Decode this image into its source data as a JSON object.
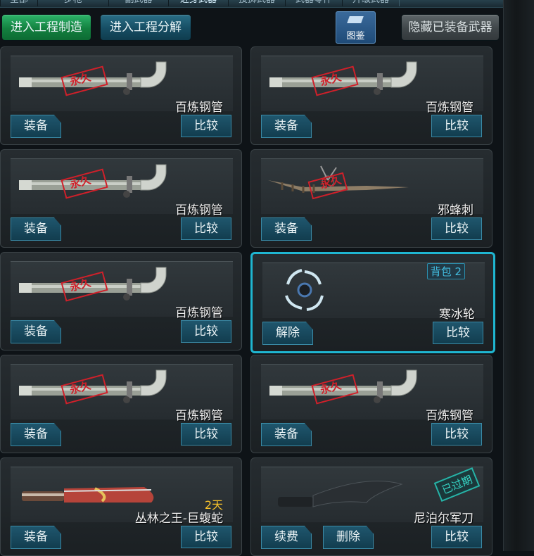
{
  "top_tabs": [
    "全部",
    "步枪",
    "副武器",
    "近身武器",
    "投掷武器",
    "武器零件",
    "升级武器"
  ],
  "toolbar": {
    "engineer_make": "进入工程制造",
    "engineer_disassemble": "进入工程分解",
    "codex": "图鉴",
    "hide_equipped": "隐藏已装备武器"
  },
  "cards": [
    {
      "name": "百炼钢管",
      "weapon": "pipe",
      "stamp": "永久",
      "actions": [
        "装备"
      ],
      "compare": "比较"
    },
    {
      "name": "百炼钢管",
      "weapon": "pipe",
      "stamp": "永久",
      "actions": [
        "装备"
      ],
      "compare": "比较"
    },
    {
      "name": "百炼钢管",
      "weapon": "pipe",
      "stamp": "永久",
      "actions": [
        "装备"
      ],
      "compare": "比较"
    },
    {
      "name": "邪蜂刺",
      "weapon": "stinger",
      "stamp": "永久",
      "actions": [
        "装备"
      ],
      "compare": "比较"
    },
    {
      "name": "百炼钢管",
      "weapon": "pipe",
      "stamp": "永久",
      "actions": [
        "装备"
      ],
      "compare": "比较"
    },
    {
      "name": "寒冰轮",
      "weapon": "shuriken",
      "badge": "背包 2",
      "selected": true,
      "actions": [
        "解除"
      ],
      "compare": "比较"
    },
    {
      "name": "百炼钢管",
      "weapon": "pipe",
      "stamp": "永久",
      "actions": [
        "装备"
      ],
      "compare": "比较"
    },
    {
      "name": "百炼钢管",
      "weapon": "pipe",
      "stamp": "永久",
      "actions": [
        "装备"
      ],
      "compare": "比较"
    },
    {
      "name": "丛林之王-巨蝮蛇",
      "weapon": "machete",
      "timer": "2天",
      "actions": [
        "装备"
      ],
      "compare": "比较"
    },
    {
      "name": "尼泊尔军刀",
      "weapon": "kukri",
      "status": "已过期",
      "actions": [
        "续费",
        "删除"
      ],
      "compare": "比较"
    }
  ],
  "colors": {
    "accent": "#1fb6d1",
    "green": "#13803f",
    "timer": "#f6c12b",
    "stamp_red": "#d0202a"
  }
}
